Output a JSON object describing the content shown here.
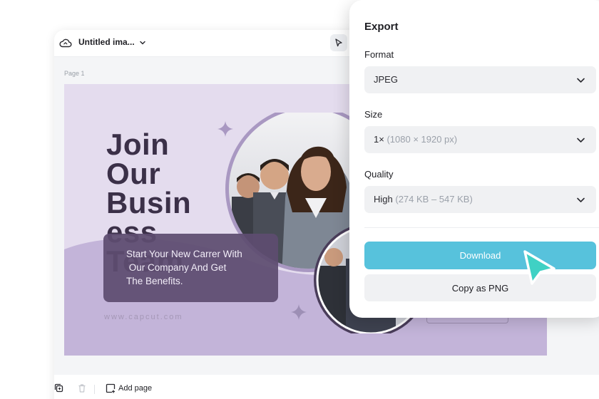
{
  "editor": {
    "title": "Untitled ima...",
    "page_label": "Page 1"
  },
  "design": {
    "headline": "Join\nOur\nBusin\ness\nTeam",
    "card_text": "Start Your New Carrer With\n Our Company And Get\nThe Benefits.",
    "url": "www.capcut.com"
  },
  "bottom_bar": {
    "add_page_label": "Add page"
  },
  "export_panel": {
    "title": "Export",
    "format": {
      "label": "Format",
      "value": "JPEG"
    },
    "size": {
      "label": "Size",
      "value": "1×",
      "hint": "(1080 × 1920 px)"
    },
    "quality": {
      "label": "Quality",
      "value": "High",
      "hint": "(274 KB – 547 KB)"
    },
    "download_label": "Download",
    "copy_label": "Copy as PNG"
  },
  "colors": {
    "accent": "#57c2dc",
    "canvas_background": "#e4dcee",
    "text_card": "#5e4c70",
    "headline": "#3b3048"
  },
  "icons": [
    "cloud-icon",
    "chevron-down-icon",
    "pointer-icon",
    "duplicate-icon",
    "trash-icon",
    "add-page-icon",
    "sparkle-icon",
    "cursor-icon"
  ]
}
